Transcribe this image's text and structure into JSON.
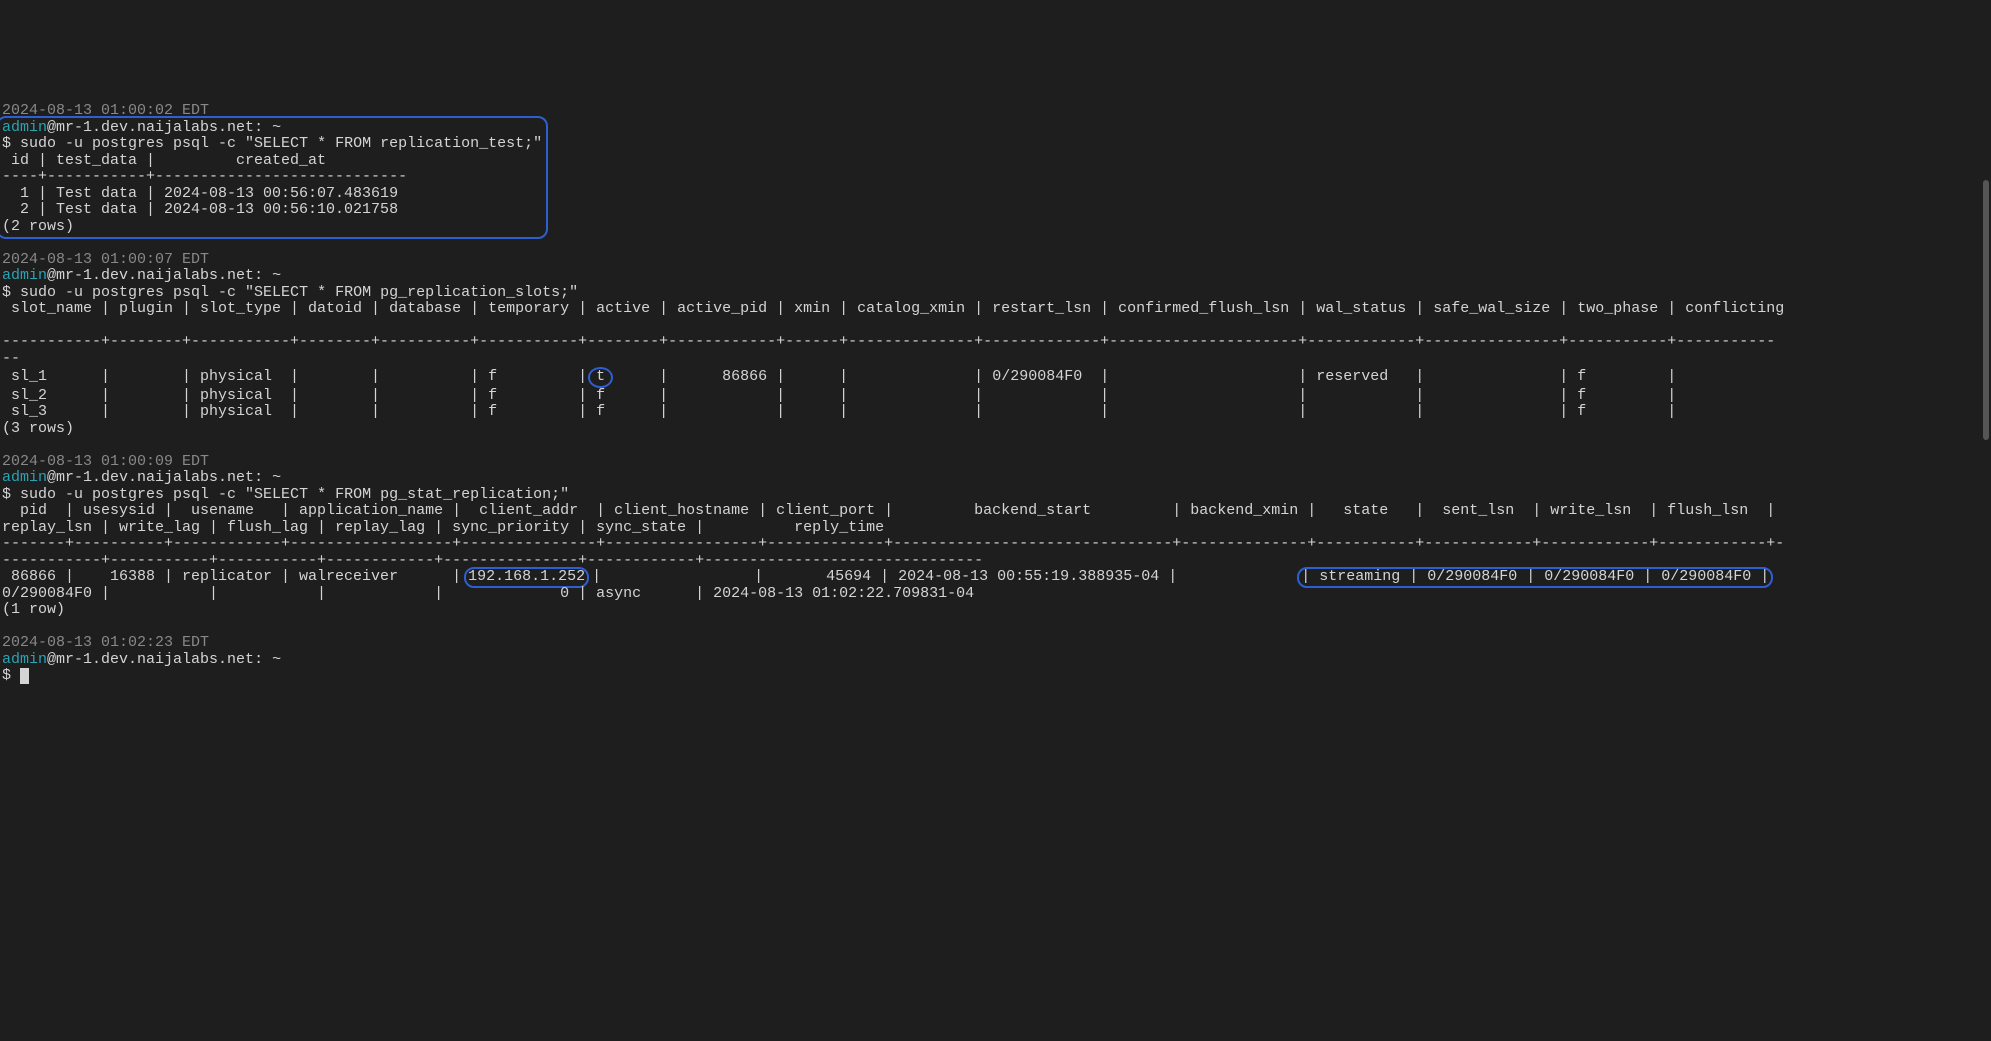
{
  "block1": {
    "ts": "2024-08-13 01:00:02 EDT",
    "user": "admin",
    "at": "@",
    "host": "mr-1.dev.naijalabs.net",
    "path": ": ~",
    "cmd": " sudo -u postgres psql -c \"SELECT * FROM replication_test;\"",
    "header": " id | test_data |         created_at",
    "sep": "----+-----------+----------------------------",
    "row1": "  1 | Test data | 2024-08-13 00:56:07.483619",
    "row2": "  2 | Test data | 2024-08-13 00:56:10.021758",
    "count": "(2 rows)"
  },
  "block2": {
    "ts": "2024-08-13 01:00:07 EDT",
    "user": "admin",
    "at": "@",
    "host": "mr-1.dev.naijalabs.net",
    "path": ": ~",
    "cmd": " sudo -u postgres psql -c \"SELECT * FROM pg_replication_slots;\"",
    "header": " slot_name | plugin | slot_type | datoid | database | temporary | active | active_pid | xmin | catalog_xmin | restart_lsn | confirmed_flush_lsn | wal_status | safe_wal_size | two_phase | conflicting",
    "sep1": "-----------+--------+-----------+--------+----------+-----------+--------+------------+------+--------------+-------------+---------------------+------------+---------------+-----------+-----------",
    "sep2": "--",
    "row1a": " sl_1      |        | physical  |        |          | f         | ",
    "row1b_t": "t",
    "row1c": "      |      86866 |      |              | 0/290084F0  |                     | reserved   |               | f         |",
    "row2": " sl_2      |        | physical  |        |          | f         | f      |            |      |              |             |                     |            |               | f         |",
    "row3": " sl_3      |        | physical  |        |          | f         | f      |            |      |              |             |                     |            |               | f         |",
    "count": "(3 rows)"
  },
  "block3": {
    "ts": "2024-08-13 01:00:09 EDT",
    "user": "admin",
    "at": "@",
    "host": "mr-1.dev.naijalabs.net",
    "path": ": ~",
    "cmd": " sudo -u postgres psql -c \"SELECT * FROM pg_stat_replication;\"",
    "header": "  pid  | usesysid |  usename   | application_name |  client_addr  | client_hostname | client_port |         backend_start         | backend_xmin |   state   |  sent_lsn  | write_lsn  | flush_lsn  | ",
    "header2": "replay_lsn | write_lag | flush_lag | replay_lag | sync_priority | sync_state |          reply_time",
    "sep1": "-------+----------+------------+------------------+---------------+-----------------+-------------+-------------------------------+--------------+-----------+------------+------------+------------+-",
    "sep2": "-----------+-----------+-----------+------------+---------------+------------+-------------------------------",
    "row1a": " 86866 |    16388 | replicator | walreceiver      | ",
    "row1_ip": "192.168.1.252",
    "row1b": " |                 |       45694 | 2024-08-13 00:55:19.388935-04 |              ",
    "row1_hl": "| streaming | 0/290084F0 | 0/290084F0 | 0/290084F0 |",
    "row2": "0/290084F0 |           |           |            |             0 | async      | 2024-08-13 01:02:22.709831-04",
    "count": "(1 row)"
  },
  "block4": {
    "ts": "2024-08-13 01:02:23 EDT",
    "user": "admin",
    "at": "@",
    "host": "mr-1.dev.naijalabs.net",
    "path": ": ~"
  },
  "chart_data": {
    "type": "table",
    "tables": [
      {
        "name": "replication_test",
        "columns": [
          "id",
          "test_data",
          "created_at"
        ],
        "rows": [
          [
            1,
            "Test data",
            "2024-08-13 00:56:07.483619"
          ],
          [
            2,
            "Test data",
            "2024-08-13 00:56:10.021758"
          ]
        ]
      },
      {
        "name": "pg_replication_slots",
        "columns": [
          "slot_name",
          "plugin",
          "slot_type",
          "datoid",
          "database",
          "temporary",
          "active",
          "active_pid",
          "xmin",
          "catalog_xmin",
          "restart_lsn",
          "confirmed_flush_lsn",
          "wal_status",
          "safe_wal_size",
          "two_phase",
          "conflicting"
        ],
        "rows": [
          [
            "sl_1",
            "",
            "physical",
            "",
            "",
            "f",
            "t",
            86866,
            "",
            "",
            "0/290084F0",
            "",
            "reserved",
            "",
            "f",
            ""
          ],
          [
            "sl_2",
            "",
            "physical",
            "",
            "",
            "f",
            "f",
            "",
            "",
            "",
            "",
            "",
            "",
            "",
            "f",
            ""
          ],
          [
            "sl_3",
            "",
            "physical",
            "",
            "",
            "f",
            "f",
            "",
            "",
            "",
            "",
            "",
            "",
            "",
            "f",
            ""
          ]
        ]
      },
      {
        "name": "pg_stat_replication",
        "columns": [
          "pid",
          "usesysid",
          "usename",
          "application_name",
          "client_addr",
          "client_hostname",
          "client_port",
          "backend_start",
          "backend_xmin",
          "state",
          "sent_lsn",
          "write_lsn",
          "flush_lsn",
          "replay_lsn",
          "write_lag",
          "flush_lag",
          "replay_lag",
          "sync_priority",
          "sync_state",
          "reply_time"
        ],
        "rows": [
          [
            86866,
            16388,
            "replicator",
            "walreceiver",
            "192.168.1.252",
            "",
            45694,
            "2024-08-13 00:55:19.388935-04",
            "",
            "streaming",
            "0/290084F0",
            "0/290084F0",
            "0/290084F0",
            "0/290084F0",
            "",
            "",
            "",
            0,
            "async",
            "2024-08-13 01:02:22.709831-04"
          ]
        ]
      }
    ]
  }
}
